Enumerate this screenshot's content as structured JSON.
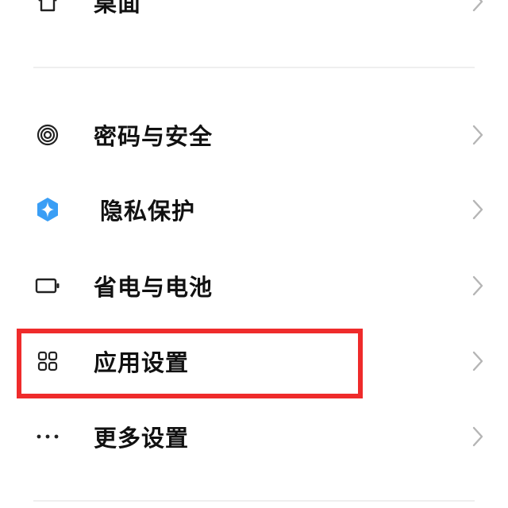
{
  "settings": {
    "items": [
      {
        "label": "桌面",
        "icon": "home-icon"
      },
      {
        "label": "密码与安全",
        "icon": "fingerprint-icon"
      },
      {
        "label": "隐私保护",
        "icon": "privacy-shield-icon"
      },
      {
        "label": "省电与电池",
        "icon": "battery-icon"
      },
      {
        "label": "应用设置",
        "icon": "apps-grid-icon"
      },
      {
        "label": "更多设置",
        "icon": "more-dots-icon"
      }
    ]
  },
  "annotation": {
    "highlight_color": "#ef2b2b",
    "highlighted_item": "应用设置"
  },
  "colors": {
    "text": "#111111",
    "chevron": "#b5b5b5",
    "icon": "#222222",
    "privacy_accent": "#3a9ef5",
    "divider": "#efefef"
  }
}
